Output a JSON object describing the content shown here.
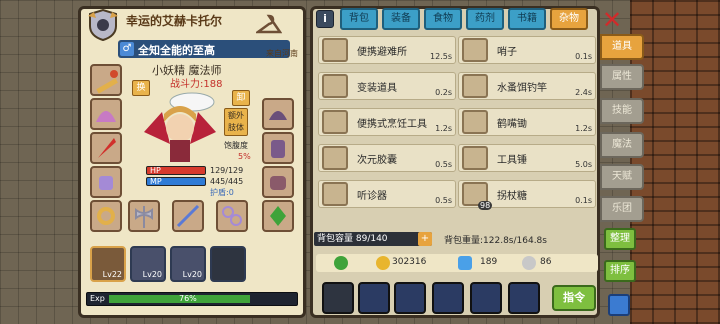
{
  "character": {
    "title": "幸运的艾赫卡托尔",
    "epithet": "全知全能的至高",
    "gender_symbol": "♂",
    "origin": "来自河南",
    "name": "小妖精 魔法师",
    "combat_power": "战斗力:188",
    "skill_btn": "换",
    "skill_btn2": "卸",
    "extra_body": "额外肢体",
    "satiety_label": "饱腹度",
    "satiety_value": "5%",
    "hp_label": "HP",
    "hp_value": "129/129",
    "hp_ratio": 1.0,
    "mp_label": "MP",
    "mp_value": "445/445",
    "mp_ratio": 1.0,
    "shield_label": "护盾:0"
  },
  "party": [
    {
      "level": "Lv22"
    },
    {
      "level": "Lv20"
    },
    {
      "level": "Lv20"
    },
    {
      "level": ""
    }
  ],
  "exp": {
    "label": "Exp",
    "percent_text": "76%",
    "ratio": 0.76
  },
  "tabs": [
    {
      "label": "背包"
    },
    {
      "label": "装备"
    },
    {
      "label": "食物"
    },
    {
      "label": "药剂"
    },
    {
      "label": "书籍"
    },
    {
      "label": "杂物",
      "active": true
    }
  ],
  "info_label": "i",
  "items": [
    {
      "name": "便携避难所",
      "time": "12.5s",
      "icon": "house-icon"
    },
    {
      "name": "哨子",
      "time": "0.1s",
      "icon": "whistle-icon"
    },
    {
      "name": "变装道具",
      "time": "0.2s",
      "icon": "disguise-icon"
    },
    {
      "name": "水蚤饵钓竿",
      "time": "2.4s",
      "icon": "fishing-rod-icon"
    },
    {
      "name": "便携式烹饪工具",
      "time": "1.2s",
      "icon": "cooking-icon"
    },
    {
      "name": "鹤嘴锄",
      "time": "1.2s",
      "icon": "pickaxe-icon"
    },
    {
      "name": "次元胶囊",
      "time": "0.5s",
      "icon": "capsule-icon"
    },
    {
      "name": "工具锤",
      "time": "5.0s",
      "icon": "hammer-icon"
    },
    {
      "name": "听诊器",
      "time": "0.5s",
      "icon": "stethoscope-icon"
    },
    {
      "name": "拐杖糖",
      "time": "0.1s",
      "icon": "candy-cane-icon",
      "qty": "98"
    }
  ],
  "bag": {
    "capacity": "背包容量 89/140",
    "weight": "背包重量:122.8s/164.8s"
  },
  "currency": {
    "gold": "302316",
    "gem": "189",
    "token": "86"
  },
  "command_label": "指令",
  "side_tabs": [
    {
      "label": "道具",
      "active": true
    },
    {
      "label": "属性"
    },
    {
      "label": "技能"
    },
    {
      "label": "魔法"
    },
    {
      "label": "天赋"
    },
    {
      "label": "乐团"
    }
  ],
  "sort_buttons": {
    "tidy": "整理",
    "sort": "排序"
  }
}
